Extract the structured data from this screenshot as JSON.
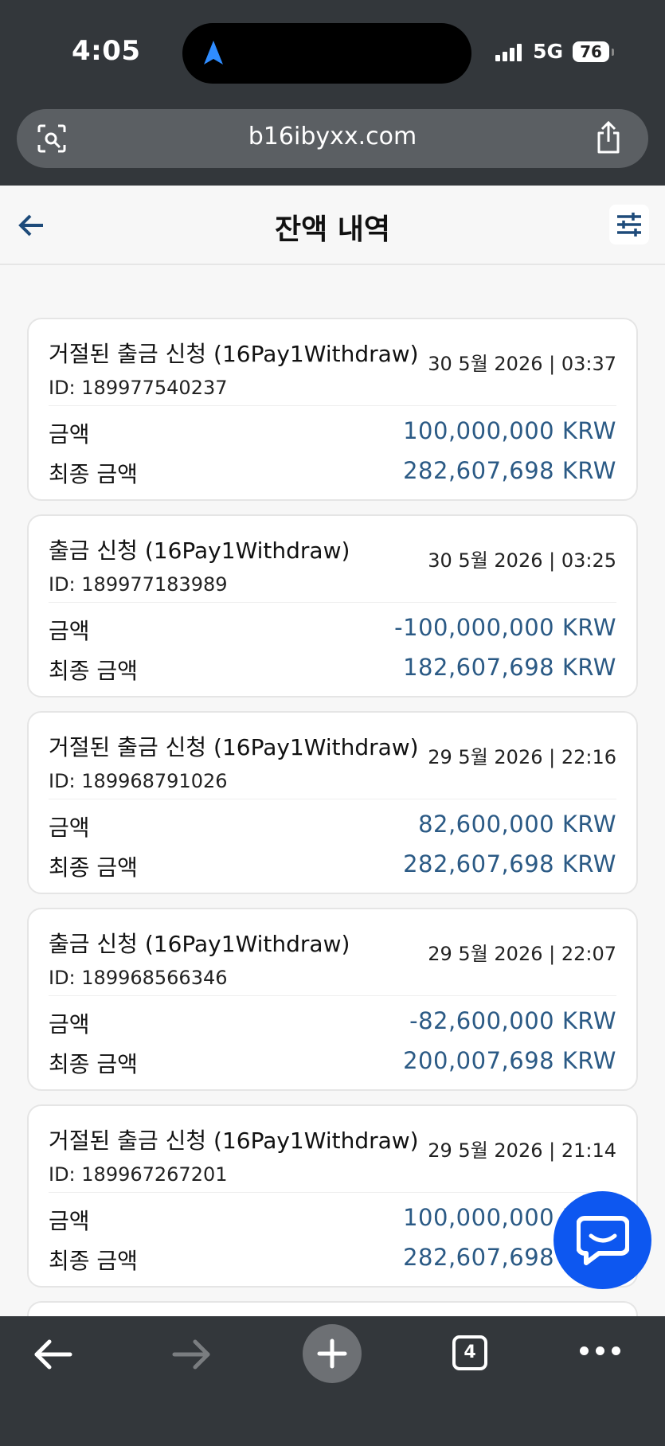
{
  "status_bar": {
    "time": "4:05",
    "network": "5G",
    "battery": "76"
  },
  "browser": {
    "url": "b16ibyxx.com",
    "tab_count": "4"
  },
  "header": {
    "title": "잔액 내역"
  },
  "transactions": [
    {
      "title": "거절된 출금 신청 (16Pay1Withdraw)",
      "date": "30 5월 2026 | 03:37",
      "id": "ID: 189977540237",
      "amount_label": "금액",
      "amount": "100,000,000 KRW",
      "final_label": "최종 금액",
      "final": "282,607,698 KRW"
    },
    {
      "title": "출금 신청 (16Pay1Withdraw)",
      "date": "30 5월 2026 | 03:25",
      "id": "ID: 189977183989",
      "amount_label": "금액",
      "amount": "-100,000,000 KRW",
      "final_label": "최종 금액",
      "final": "182,607,698 KRW"
    },
    {
      "title": "거절된 출금 신청 (16Pay1Withdraw)",
      "date": "29 5월 2026 | 22:16",
      "id": "ID: 189968791026",
      "amount_label": "금액",
      "amount": "82,600,000 KRW",
      "final_label": "최종 금액",
      "final": "282,607,698 KRW"
    },
    {
      "title": "출금 신청 (16Pay1Withdraw)",
      "date": "29 5월 2026 | 22:07",
      "id": "ID: 189968566346",
      "amount_label": "금액",
      "amount": "-82,600,000 KRW",
      "final_label": "최종 금액",
      "final": "200,007,698 KRW"
    },
    {
      "title": "거절된 출금 신청 (16Pay1Withdraw)",
      "date": "29 5월 2026 | 21:14",
      "id": "ID: 189967267201",
      "amount_label": "금액",
      "amount": "100,000,000 KRW",
      "final_label": "최종 금액",
      "final": "282,607,698 KRW"
    }
  ],
  "icons": {
    "back": "arrow-left-icon",
    "filter": "sliders-icon",
    "chat": "chat-bubble-icon",
    "camera_search": "camera-search-icon",
    "share": "share-icon"
  },
  "colors": {
    "accent": "#2b5a85",
    "chat_fab": "#0d57f0",
    "browser_chrome": "#33373b"
  }
}
